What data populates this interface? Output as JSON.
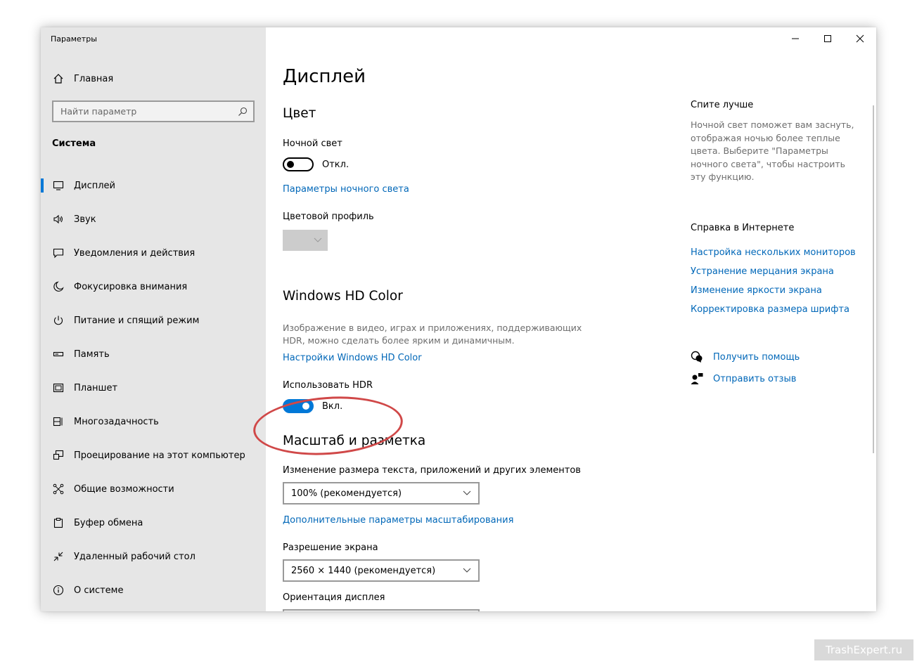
{
  "window": {
    "title": "Параметры",
    "controls": {
      "minimize": "minimize-icon",
      "maximize": "maximize-icon",
      "close": "close-icon"
    }
  },
  "sidebar": {
    "home_label": "Главная",
    "search_placeholder": "Найти параметр",
    "section_title": "Система",
    "items": [
      {
        "label": "Дисплей",
        "icon": "monitor-icon",
        "active": true
      },
      {
        "label": "Звук",
        "icon": "speaker-icon"
      },
      {
        "label": "Уведомления и действия",
        "icon": "notification-icon"
      },
      {
        "label": "Фокусировка внимания",
        "icon": "moon-icon"
      },
      {
        "label": "Питание и спящий режим",
        "icon": "power-icon"
      },
      {
        "label": "Память",
        "icon": "storage-icon"
      },
      {
        "label": "Планшет",
        "icon": "tablet-icon"
      },
      {
        "label": "Многозадачность",
        "icon": "multitasking-icon"
      },
      {
        "label": "Проецирование на этот компьютер",
        "icon": "projection-icon"
      },
      {
        "label": "Общие возможности",
        "icon": "shared-experiences-icon"
      },
      {
        "label": "Буфер обмена",
        "icon": "clipboard-icon"
      },
      {
        "label": "Удаленный рабочий стол",
        "icon": "remote-desktop-icon"
      },
      {
        "label": "О системе",
        "icon": "info-icon"
      }
    ]
  },
  "main": {
    "title": "Дисплей",
    "color": {
      "heading": "Цвет",
      "night_light_label": "Ночной свет",
      "night_light_state": "Откл.",
      "night_light_on": false,
      "night_light_link": "Параметры ночного света",
      "color_profile_label": "Цветовой профиль"
    },
    "hd_color": {
      "heading": "Windows HD Color",
      "description": "Изображение в видео, играх и приложениях, поддерживающих HDR, можно сделать более ярким и динамичным.",
      "link": "Настройки Windows HD Color",
      "hdr_label": "Использовать HDR",
      "hdr_state": "Вкл.",
      "hdr_on": true
    },
    "scale": {
      "heading": "Масштаб и разметка",
      "scale_label": "Изменение размера текста, приложений и других элементов",
      "scale_value": "100% (рекомендуется)",
      "advanced_link": "Дополнительные параметры масштабирования",
      "resolution_label": "Разрешение экрана",
      "resolution_value": "2560 × 1440 (рекомендуется)",
      "orientation_label": "Ориентация дисплея"
    }
  },
  "right": {
    "sleep_heading": "Спите лучше",
    "sleep_text": "Ночной свет поможет вам заснуть, отображая ночью более теплые цвета. Выберите \"Параметры ночного света\", чтобы настроить эту функцию.",
    "web_help_heading": "Справка в Интернете",
    "links": [
      "Настройка нескольких мониторов",
      "Устранение мерцания экрана",
      "Изменение яркости экрана",
      "Корректировка размера шрифта"
    ],
    "get_help": "Получить помощь",
    "feedback": "Отправить отзыв"
  },
  "watermark": "TrashExpert.ru",
  "colors": {
    "accent": "#0078d7",
    "link": "#0067b8",
    "highlight_circle": "#d04848",
    "sidebar_bg": "#e6e6e6"
  }
}
